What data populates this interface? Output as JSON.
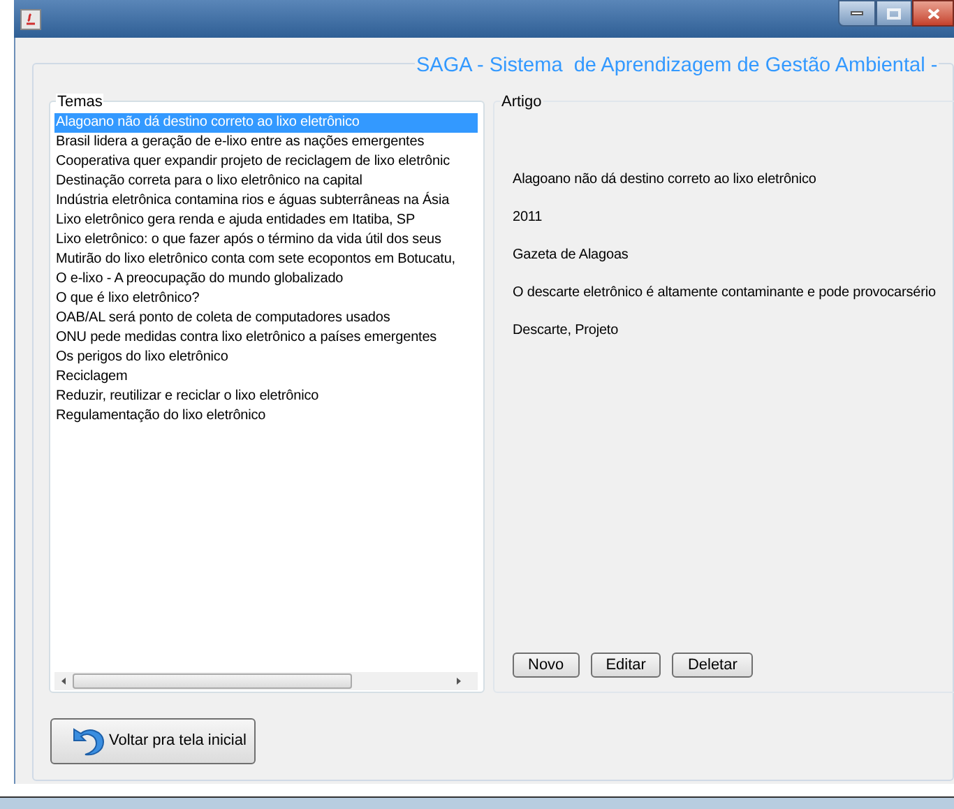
{
  "window": {
    "title": "SAGA - Sistema  de Aprendizagem de Gestão Ambiental -"
  },
  "temas": {
    "label": "Temas",
    "items": [
      {
        "text": "Alagoano não dá destino correto ao lixo eletrônico",
        "selected": true
      },
      {
        "text": "Brasil lidera a geração de e-lixo entre as nações emergentes",
        "selected": false
      },
      {
        "text": "Cooperativa quer expandir projeto de reciclagem de lixo eletrônic",
        "selected": false
      },
      {
        "text": "Destinação correta para o lixo eletrônico na capital",
        "selected": false
      },
      {
        "text": "Indústria eletrônica contamina rios e águas subterrâneas na Ásia",
        "selected": false
      },
      {
        "text": "Lixo eletrônico gera renda e ajuda entidades em Itatiba, SP",
        "selected": false
      },
      {
        "text": "Lixo eletrônico: o que fazer após o término da vida útil dos seus",
        "selected": false
      },
      {
        "text": "Mutirão do lixo eletrônico conta com sete ecopontos em Botucatu,",
        "selected": false
      },
      {
        "text": "O e-lixo - A preocupação do mundo globalizado",
        "selected": false
      },
      {
        "text": "O que é lixo eletrônico?",
        "selected": false
      },
      {
        "text": "OAB/AL será ponto de coleta de computadores usados",
        "selected": false
      },
      {
        "text": "ONU pede medidas contra lixo eletrônico a países emergentes",
        "selected": false
      },
      {
        "text": "Os perigos do lixo eletrônico",
        "selected": false
      },
      {
        "text": "Reciclagem",
        "selected": false
      },
      {
        "text": "Reduzir, reutilizar e reciclar o lixo eletrônico",
        "selected": false
      },
      {
        "text": "Regulamentação do lixo eletrônico",
        "selected": false
      }
    ]
  },
  "artigo": {
    "label": "Artigo",
    "fields": [
      "Alagoano não dá destino correto ao lixo eletrônico",
      "2011",
      "Gazeta de Alagoas",
      "O descarte eletrônico é altamente contaminante e pode provocarsério",
      "Descarte, Projeto"
    ],
    "buttons": [
      "Novo",
      "Editar",
      "Deletar"
    ]
  },
  "back_button": "Voltar pra tela inicial"
}
